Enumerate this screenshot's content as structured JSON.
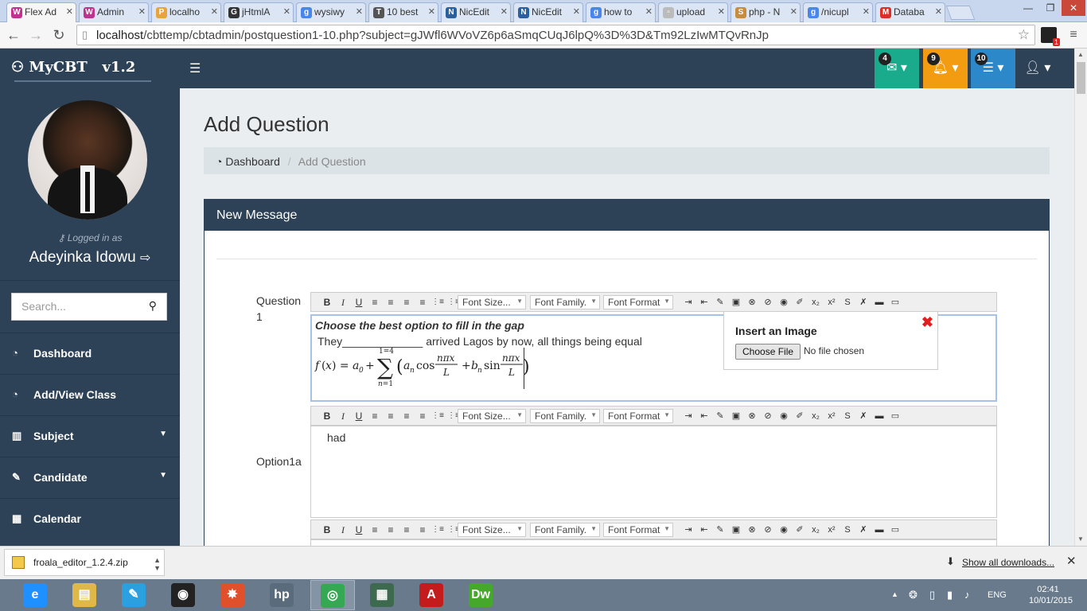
{
  "browser": {
    "tabs": [
      {
        "title": "Flex Ad",
        "active": true,
        "color": "#c0328f",
        "glyph": "W"
      },
      {
        "title": "Admin",
        "active": false,
        "color": "#c0328f",
        "glyph": "W"
      },
      {
        "title": "localho",
        "active": false,
        "color": "#e8a33a",
        "glyph": "P"
      },
      {
        "title": "jHtmlA",
        "active": false,
        "color": "#333333",
        "glyph": "G"
      },
      {
        "title": "wysiwy",
        "active": false,
        "color": "#4a86e8",
        "glyph": "g"
      },
      {
        "title": "10 best",
        "active": false,
        "color": "#555555",
        "glyph": "T"
      },
      {
        "title": "NicEdit",
        "active": false,
        "color": "#2c5f9e",
        "glyph": "N"
      },
      {
        "title": "NicEdit",
        "active": false,
        "color": "#2c5f9e",
        "glyph": "N"
      },
      {
        "title": "how to",
        "active": false,
        "color": "#4a86e8",
        "glyph": "g"
      },
      {
        "title": "upload",
        "active": false,
        "color": "#bbbbbb",
        "glyph": "▫"
      },
      {
        "title": "php - N",
        "active": false,
        "color": "#c98b3c",
        "glyph": "S"
      },
      {
        "title": "/nicupl",
        "active": false,
        "color": "#4a86e8",
        "glyph": "g"
      },
      {
        "title": "Databa",
        "active": false,
        "color": "#d93025",
        "glyph": "M"
      }
    ],
    "url_host": "localhost",
    "url_path": "/cbttemp/cbtadmin/postquestion1-10.php?subject=gJWfl6WVoVZ6p6aSmqCUqJ6lpQ%3D%3D&Tm92LzIwMTQvRnJp",
    "ext_badge": "1"
  },
  "app": {
    "logo_text": "MyCBT   v1.2",
    "notifications": [
      {
        "count": "4",
        "icon": "envelope-icon",
        "color": "#1aaa8c"
      },
      {
        "count": "9",
        "icon": "bell-icon",
        "color": "#f39c12"
      },
      {
        "count": "10",
        "icon": "tasks-icon",
        "color": "#2c88c8"
      }
    ],
    "user_menu_icon": "user-icon"
  },
  "sidebar": {
    "logged_in_label": "Logged in as",
    "user_name": "Adeyinka Idowu",
    "search_placeholder": "Search...",
    "items": [
      {
        "label": "Dashboard",
        "icon": "dashboard-icon",
        "caret": false
      },
      {
        "label": "Add/View Class",
        "icon": "dashboard-icon",
        "caret": false
      },
      {
        "label": "Subject",
        "icon": "bar-chart-icon",
        "caret": true
      },
      {
        "label": "Candidate",
        "icon": "edit-icon",
        "caret": true
      },
      {
        "label": "Calendar",
        "icon": "calendar-icon",
        "caret": false
      }
    ]
  },
  "page": {
    "title": "Add Question",
    "breadcrumb": {
      "home": "Dashboard",
      "current": "Add Question"
    },
    "panel_title": "New Message",
    "question_label_1": "Question",
    "question_label_2": "1",
    "option_label": "Option1a",
    "toolbar": {
      "bold": "B",
      "italic": "I",
      "underline": "U",
      "font_size": "Font Size...",
      "font_family": "Font Family.",
      "font_format": "Font Format"
    },
    "question_editor": {
      "line1": "Choose the best option to fill in the gap",
      "line2": "They_____________ arrived Lagos by now, all things being equal"
    },
    "option_editor": {
      "text": "had"
    },
    "image_popup": {
      "title": "Insert an Image",
      "button": "Choose File",
      "status": "No file chosen"
    }
  },
  "downloads": {
    "file": "froala_editor_1.2.4.zip",
    "show_all": "Show all downloads..."
  },
  "taskbar": {
    "apps": [
      {
        "name": "ie-icon",
        "color": "#1e90ff",
        "glyph": "e"
      },
      {
        "name": "file-explorer-icon",
        "color": "#e0b84a",
        "glyph": "▤"
      },
      {
        "name": "tool-icon",
        "color": "#2aa0e0",
        "glyph": "✎"
      },
      {
        "name": "camera-icon",
        "color": "#222222",
        "glyph": "◉"
      },
      {
        "name": "paint-icon",
        "color": "#e0502a",
        "glyph": "✸"
      },
      {
        "name": "hp-icon",
        "color": "#5a6b7c",
        "glyph": "hp"
      },
      {
        "name": "chrome-icon",
        "color": "#34a853",
        "glyph": "◎"
      },
      {
        "name": "document-icon",
        "color": "#3d6a4f",
        "glyph": "▦"
      },
      {
        "name": "acrobat-icon",
        "color": "#c41c1c",
        "glyph": "A"
      },
      {
        "name": "dreamweaver-icon",
        "color": "#45a82a",
        "glyph": "Dw"
      }
    ],
    "language": "ENG",
    "time": "02:41",
    "date": "10/01/2015"
  }
}
